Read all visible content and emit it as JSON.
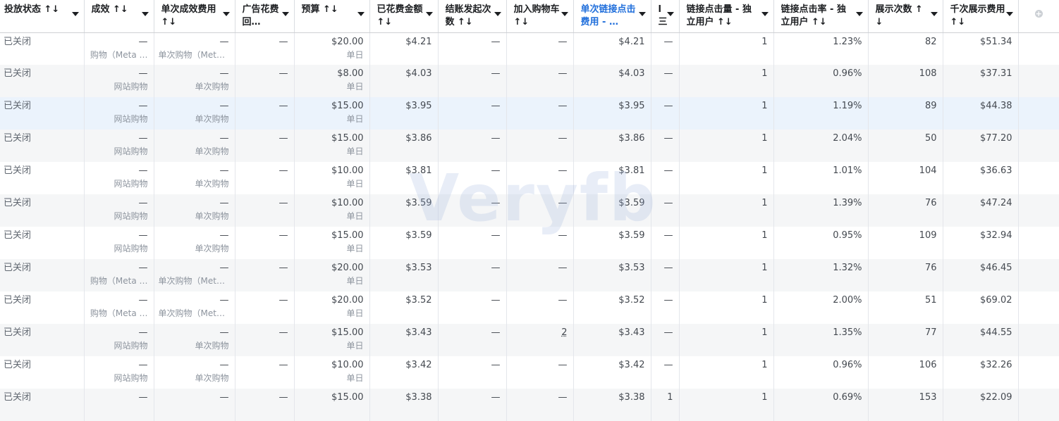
{
  "columns": [
    {
      "label": "投放状态 ↑↓",
      "w": 119,
      "cls": "first"
    },
    {
      "label": "成效 ↑↓",
      "w": 99
    },
    {
      "label": "单次成效费用 ↑↓",
      "w": 115
    },
    {
      "label": "广告花费回…",
      "w": 84
    },
    {
      "label": "预算 ↑↓",
      "w": 107
    },
    {
      "label": "已花费金额 ↑↓",
      "w": 97
    },
    {
      "label": "结账发起次数 ↑↓",
      "w": 97
    },
    {
      "label": "加入购物车 ↑↓",
      "w": 95
    },
    {
      "label": "单次链接点击费用 - …",
      "w": 110,
      "cls": "highlight"
    },
    {
      "label": "l 三",
      "w": 40
    },
    {
      "label": "链接点击量 - 独立用户 ↑↓",
      "w": 134
    },
    {
      "label": "链接点击率 - 独立用户 ↑↓",
      "w": 134
    },
    {
      "label": "展示次数 ↑↓",
      "w": 106
    },
    {
      "label": "千次展示费用 ↑↓",
      "w": 107
    }
  ],
  "rows": [
    {
      "status": "已关闭",
      "result": "—",
      "result_sub": "购物（Meta …",
      "cpr": "—",
      "cpr_sub": "单次购物（Meta…",
      "roas": "—",
      "budget": "$20.00",
      "budget_sub": "单日",
      "spent": "$4.21",
      "checkout": "—",
      "cart": "—",
      "cpc": "$4.21",
      "c10": "—",
      "clicks": "1",
      "ctr": "1.23%",
      "impr": "82",
      "cpm": "$51.34"
    },
    {
      "status": "已关闭",
      "result": "—",
      "result_sub": "网站购物",
      "cpr": "—",
      "cpr_sub": "单次购物",
      "roas": "—",
      "budget": "$8.00",
      "budget_sub": "单日",
      "spent": "$4.03",
      "checkout": "—",
      "cart": "—",
      "cpc": "$4.03",
      "c10": "—",
      "clicks": "1",
      "ctr": "0.96%",
      "impr": "108",
      "cpm": "$37.31"
    },
    {
      "status": "已关闭",
      "result": "—",
      "result_sub": "网站购物",
      "cpr": "—",
      "cpr_sub": "单次购物",
      "roas": "—",
      "budget": "$15.00",
      "budget_sub": "单日",
      "spent": "$3.95",
      "checkout": "—",
      "cart": "—",
      "cpc": "$3.95",
      "c10": "—",
      "clicks": "1",
      "ctr": "1.19%",
      "impr": "89",
      "cpm": "$44.38",
      "selected": true
    },
    {
      "status": "已关闭",
      "result": "—",
      "result_sub": "网站购物",
      "cpr": "—",
      "cpr_sub": "单次购物",
      "roas": "—",
      "budget": "$15.00",
      "budget_sub": "单日",
      "spent": "$3.86",
      "checkout": "—",
      "cart": "—",
      "cpc": "$3.86",
      "c10": "—",
      "clicks": "1",
      "ctr": "2.04%",
      "impr": "50",
      "cpm": "$77.20"
    },
    {
      "status": "已关闭",
      "result": "—",
      "result_sub": "网站购物",
      "cpr": "—",
      "cpr_sub": "单次购物",
      "roas": "—",
      "budget": "$10.00",
      "budget_sub": "单日",
      "spent": "$3.81",
      "checkout": "—",
      "cart": "—",
      "cpc": "$3.81",
      "c10": "—",
      "clicks": "1",
      "ctr": "1.01%",
      "impr": "104",
      "cpm": "$36.63"
    },
    {
      "status": "已关闭",
      "result": "—",
      "result_sub": "网站购物",
      "cpr": "—",
      "cpr_sub": "单次购物",
      "roas": "—",
      "budget": "$10.00",
      "budget_sub": "单日",
      "spent": "$3.59",
      "checkout": "—",
      "cart": "—",
      "cpc": "$3.59",
      "c10": "—",
      "clicks": "1",
      "ctr": "1.39%",
      "impr": "76",
      "cpm": "$47.24"
    },
    {
      "status": "已关闭",
      "result": "—",
      "result_sub": "网站购物",
      "cpr": "—",
      "cpr_sub": "单次购物",
      "roas": "—",
      "budget": "$15.00",
      "budget_sub": "单日",
      "spent": "$3.59",
      "checkout": "—",
      "cart": "—",
      "cpc": "$3.59",
      "c10": "—",
      "clicks": "1",
      "ctr": "0.95%",
      "impr": "109",
      "cpm": "$32.94"
    },
    {
      "status": "已关闭",
      "result": "—",
      "result_sub": "购物（Meta …",
      "cpr": "—",
      "cpr_sub": "单次购物（Meta…",
      "roas": "—",
      "budget": "$20.00",
      "budget_sub": "单日",
      "spent": "$3.53",
      "checkout": "—",
      "cart": "—",
      "cpc": "$3.53",
      "c10": "—",
      "clicks": "1",
      "ctr": "1.32%",
      "impr": "76",
      "cpm": "$46.45"
    },
    {
      "status": "已关闭",
      "result": "—",
      "result_sub": "购物（Meta …",
      "cpr": "—",
      "cpr_sub": "单次购物（Meta…",
      "roas": "—",
      "budget": "$20.00",
      "budget_sub": "单日",
      "spent": "$3.52",
      "checkout": "—",
      "cart": "—",
      "cpc": "$3.52",
      "c10": "—",
      "clicks": "1",
      "ctr": "2.00%",
      "impr": "51",
      "cpm": "$69.02"
    },
    {
      "status": "已关闭",
      "result": "—",
      "result_sub": "网站购物",
      "cpr": "—",
      "cpr_sub": "单次购物",
      "roas": "—",
      "budget": "$15.00",
      "budget_sub": "单日",
      "spent": "$3.43",
      "checkout": "—",
      "cart": "2",
      "cart_link": true,
      "cpc": "$3.43",
      "c10": "—",
      "clicks": "1",
      "ctr": "1.35%",
      "impr": "77",
      "cpm": "$44.55"
    },
    {
      "status": "已关闭",
      "result": "—",
      "result_sub": "网站购物",
      "cpr": "—",
      "cpr_sub": "单次购物",
      "roas": "—",
      "budget": "$10.00",
      "budget_sub": "单日",
      "spent": "$3.42",
      "checkout": "—",
      "cart": "—",
      "cpc": "$3.42",
      "c10": "—",
      "clicks": "1",
      "ctr": "0.96%",
      "impr": "106",
      "cpm": "$32.26"
    },
    {
      "status": "已关闭",
      "result": "—",
      "result_sub": "",
      "cpr": "—",
      "cpr_sub": "",
      "roas": "—",
      "budget": "$15.00",
      "budget_sub": "",
      "spent": "$3.38",
      "checkout": "—",
      "cart": "—",
      "cpc": "$3.38",
      "c10": "1",
      "clicks": "1",
      "ctr": "0.69%",
      "impr": "153",
      "cpm": "$22.09"
    }
  ],
  "watermark": "Veryfb"
}
